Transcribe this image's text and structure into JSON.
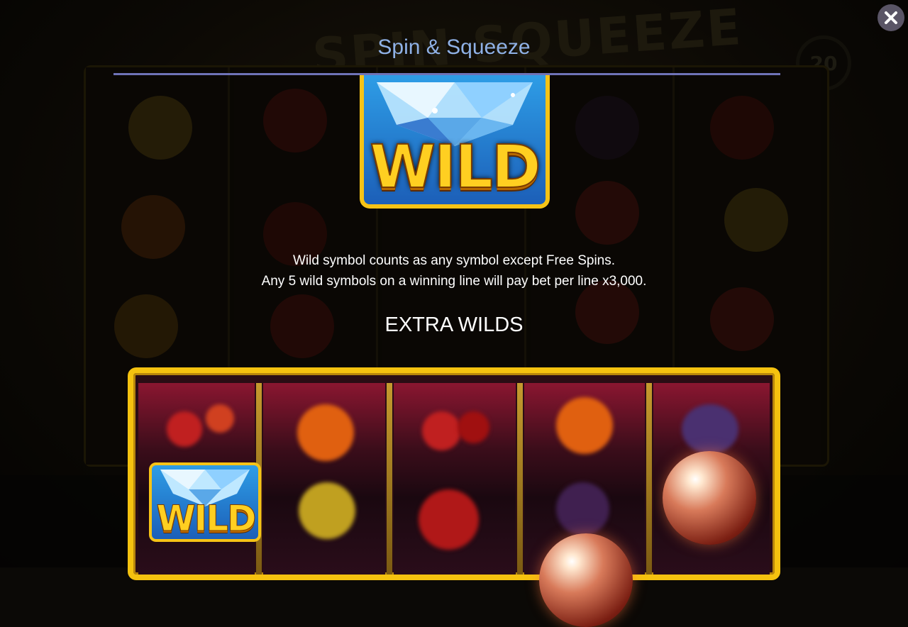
{
  "dialog": {
    "title": "Spin & Squeeze",
    "close_label": "close",
    "hero_symbol_text": "WILD",
    "description_line1": "Wild symbol counts as any symbol except Free Spins.",
    "description_line2": "Any 5 wild symbols on a winning line will pay bet per line x3,000.",
    "section_heading": "EXTRA WILDS",
    "example_wild_text": "WILD"
  },
  "background_game": {
    "logo_text": "SPIN SQUEEZE",
    "counter": "20"
  },
  "colors": {
    "title": "#8fb1e6",
    "rule": "#6f73b8",
    "gold": "#f5c20f",
    "wild_blue": "#1c5fb8"
  },
  "icons": [
    "close-icon",
    "diamond-icon",
    "bubble-icon"
  ]
}
